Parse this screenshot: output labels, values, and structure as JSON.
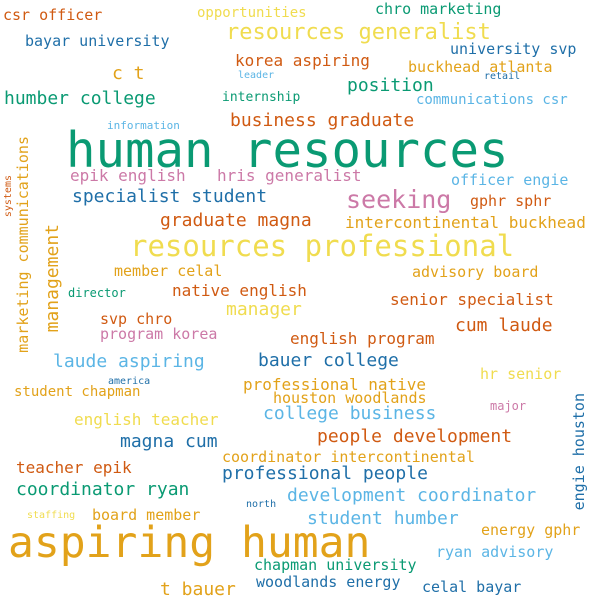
{
  "word_cloud": {
    "words": [
      {
        "text": "human resources",
        "color": "#0a9a73"
      },
      {
        "text": "aspiring human",
        "color": "#e2a21a"
      },
      {
        "text": "resources professional",
        "color": "#f0dc4f"
      },
      {
        "text": "seeking",
        "color": "#cc79a7"
      },
      {
        "text": "resources generalist",
        "color": "#f0dc4f"
      },
      {
        "text": "position",
        "color": "#0a9a73"
      },
      {
        "text": "humber college",
        "color": "#0a9a73"
      },
      {
        "text": "business graduate",
        "color": "#d05a12"
      },
      {
        "text": "specialist student",
        "color": "#1f6fa8"
      },
      {
        "text": "graduate magna",
        "color": "#d05a12"
      },
      {
        "text": "cum laude",
        "color": "#d05a12"
      },
      {
        "text": "bauer college",
        "color": "#1f6fa8"
      },
      {
        "text": "college business",
        "color": "#5bb5e5"
      },
      {
        "text": "people development",
        "color": "#d05a12"
      },
      {
        "text": "magna cum",
        "color": "#1f6fa8"
      },
      {
        "text": "professional people",
        "color": "#1f6fa8"
      },
      {
        "text": "coordinator ryan",
        "color": "#0a9a73"
      },
      {
        "text": "development coordinator",
        "color": "#5bb5e5"
      },
      {
        "text": "student humber",
        "color": "#5bb5e5"
      },
      {
        "text": "t bauer",
        "color": "#e2a21a"
      },
      {
        "text": "laude aspiring",
        "color": "#5bb5e5"
      },
      {
        "text": "manager",
        "color": "#f0dc4f"
      },
      {
        "text": "korea aspiring",
        "color": "#d05a12"
      },
      {
        "text": "c t",
        "color": "#e2a21a"
      },
      {
        "text": "epik english",
        "color": "#cc79a7"
      },
      {
        "text": "hris generalist",
        "color": "#cc79a7"
      },
      {
        "text": "officer engie",
        "color": "#5bb5e5"
      },
      {
        "text": "university svp",
        "color": "#1f6fa8"
      },
      {
        "text": "buckhead atlanta",
        "color": "#e2a21a"
      },
      {
        "text": "intercontinental buckhead",
        "color": "#e2a21a"
      },
      {
        "text": "native english",
        "color": "#d05a12"
      },
      {
        "text": "senior specialist",
        "color": "#d05a12"
      },
      {
        "text": "english program",
        "color": "#d05a12"
      },
      {
        "text": "professional native",
        "color": "#e2a21a"
      },
      {
        "text": "houston woodlands",
        "color": "#e2a21a"
      },
      {
        "text": "english teacher",
        "color": "#f0dc4f"
      },
      {
        "text": "coordinator intercontinental",
        "color": "#e2a21a"
      },
      {
        "text": "teacher epik",
        "color": "#d05a12"
      },
      {
        "text": "board member",
        "color": "#e2a21a"
      },
      {
        "text": "chapman university",
        "color": "#0a9a73"
      },
      {
        "text": "woodlands energy",
        "color": "#1f6fa8"
      },
      {
        "text": "celal bayar",
        "color": "#1f6fa8"
      },
      {
        "text": "ryan advisory",
        "color": "#5bb5e5"
      },
      {
        "text": "energy gphr",
        "color": "#e2a21a"
      },
      {
        "text": "hr senior",
        "color": "#f0dc4f"
      },
      {
        "text": "advisory board",
        "color": "#e2a21a"
      },
      {
        "text": "gphr sphr",
        "color": "#d05a12"
      },
      {
        "text": "member celal",
        "color": "#e2a21a"
      },
      {
        "text": "svp chro",
        "color": "#d05a12"
      },
      {
        "text": "program korea",
        "color": "#cc79a7"
      },
      {
        "text": "student chapman",
        "color": "#e2a21a"
      },
      {
        "text": "communications csr",
        "color": "#5bb5e5"
      },
      {
        "text": "chro marketing",
        "color": "#0a9a73"
      },
      {
        "text": "opportunities",
        "color": "#f0dc4f"
      },
      {
        "text": "csr officer",
        "color": "#d05a12"
      },
      {
        "text": "bayar university",
        "color": "#1f6fa8"
      },
      {
        "text": "internship",
        "color": "#0a9a73"
      },
      {
        "text": "leader",
        "color": "#5bb5e5"
      },
      {
        "text": "retail",
        "color": "#1f6fa8"
      },
      {
        "text": "information",
        "color": "#5bb5e5"
      },
      {
        "text": "director",
        "color": "#0a9a73"
      },
      {
        "text": "america",
        "color": "#1f6fa8"
      },
      {
        "text": "major",
        "color": "#cc79a7"
      },
      {
        "text": "north",
        "color": "#1f6fa8"
      },
      {
        "text": "staffing",
        "color": "#f0dc4f"
      },
      {
        "text": "marketing communications",
        "color": "#e2a21a"
      },
      {
        "text": "management",
        "color": "#e2a21a"
      },
      {
        "text": "systems",
        "color": "#d05a12"
      },
      {
        "text": "engie houston",
        "color": "#1f6fa8"
      }
    ]
  }
}
